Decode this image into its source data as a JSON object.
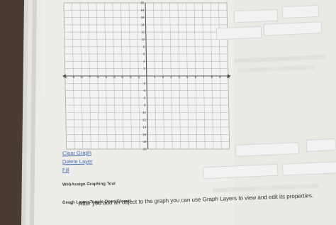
{
  "graph": {
    "x_axis_labels": [
      "-10",
      "-9",
      "-8",
      "-7",
      "-6",
      "-5",
      "-4",
      "-3",
      "-2",
      "-1",
      "1",
      "2",
      "3",
      "4",
      "5",
      "6",
      "7",
      "8",
      "9",
      "10"
    ],
    "y_axis_labels": [
      "20",
      "18",
      "16",
      "14",
      "12",
      "10",
      "8",
      "6",
      "4",
      "2",
      "-2",
      "-4",
      "-6",
      "-8",
      "-10",
      "-12",
      "-14",
      "-16",
      "-18",
      "-20"
    ],
    "x_range": [
      -10,
      10
    ],
    "y_range": [
      -20,
      20
    ],
    "grid": true
  },
  "actions": {
    "clear_graph": "Clear Graph",
    "delete_layer": "Delete Layer",
    "fill": "Fill"
  },
  "tool": {
    "title": "WebAssign Graphing Tool"
  },
  "layers": {
    "title": "Graph LayersToggle Open/Closed",
    "tip": "After you add an object to the graph you can use Graph Layers to view and edit its properties."
  },
  "colors": {
    "grid_line": "#b9b9b9",
    "axis": "#555555",
    "link": "#4a6fb6"
  }
}
